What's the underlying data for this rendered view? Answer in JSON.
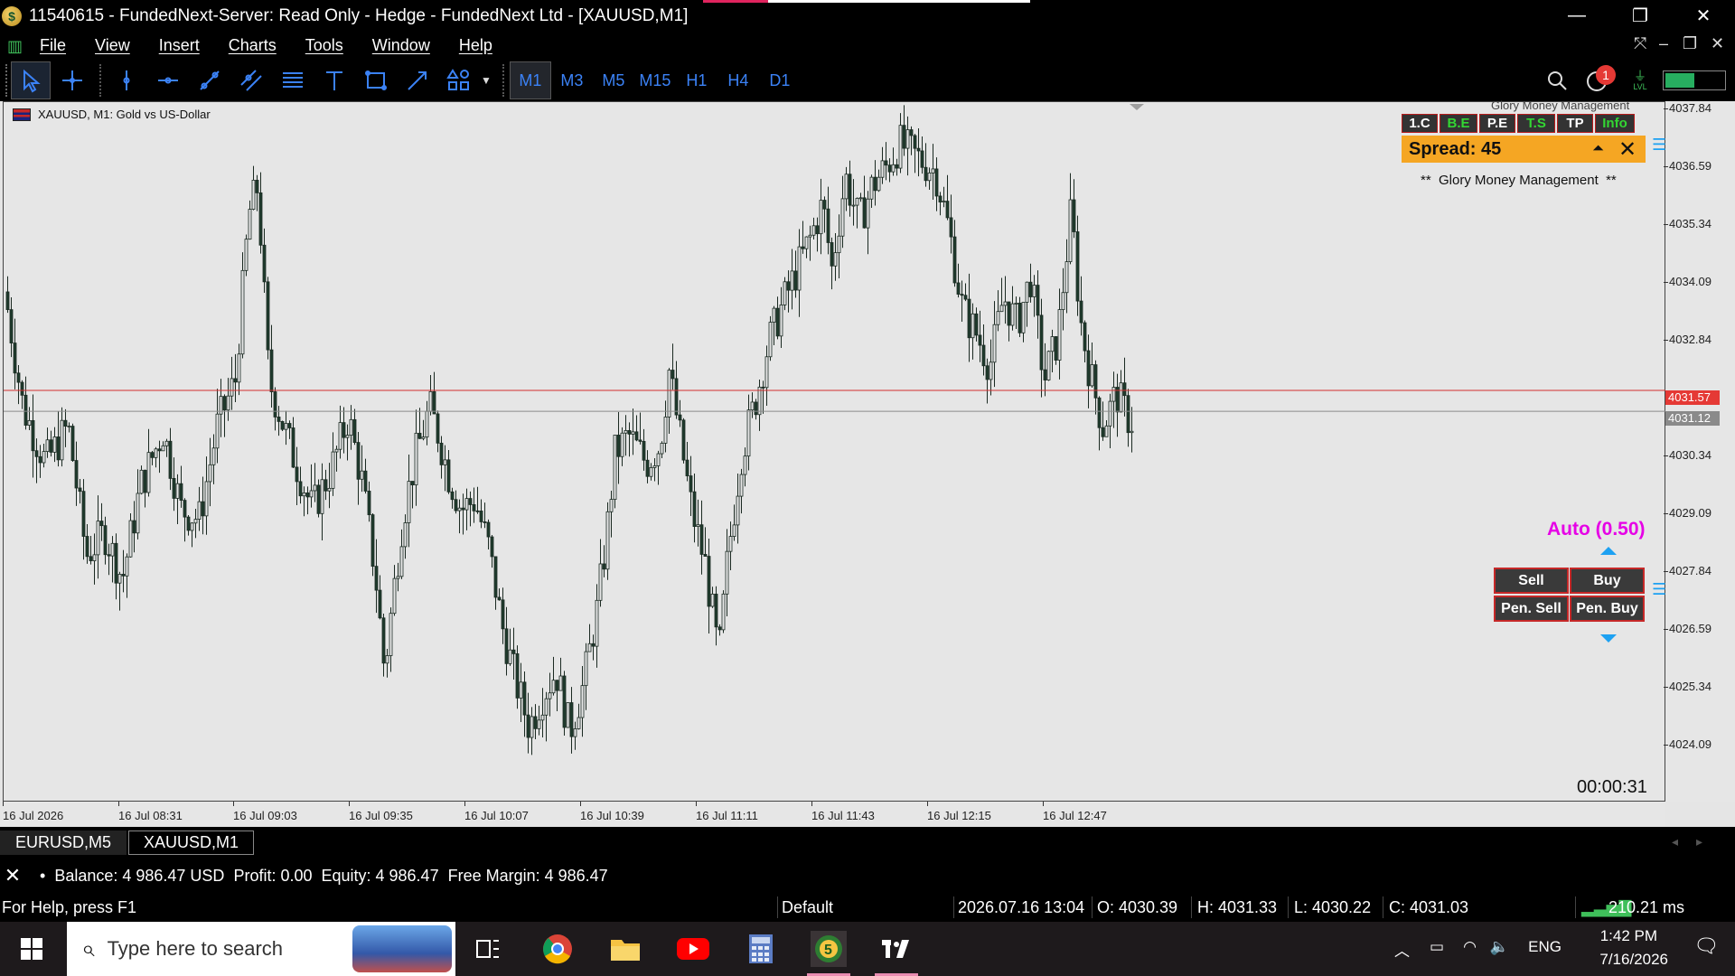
{
  "window": {
    "title": "11540615 - FundedNext-Server: Read Only - Hedge - FundedNext Ltd - [XAUUSD,M1]",
    "minimize": "—",
    "restore": "❐",
    "close": "✕"
  },
  "menu": {
    "items": [
      "File",
      "View",
      "Insert",
      "Charts",
      "Tools",
      "Window",
      "Help"
    ]
  },
  "toolbar": {
    "timeframes": [
      "M1",
      "M3",
      "M5",
      "M15",
      "H1",
      "H4",
      "D1"
    ],
    "active_timeframe": "M1",
    "notification_count": "1",
    "lvl_label": "LVL"
  },
  "chart": {
    "symbol_label": "XAUUSD, M1:  Gold vs US-Dollar",
    "price_ticks": [
      "4037.84",
      "4036.59",
      "4035.34",
      "4034.09",
      "4032.84",
      "4031.57",
      "4031.12",
      "4030.34",
      "4029.09",
      "4027.84",
      "4026.59",
      "4025.34",
      "4024.09"
    ],
    "axis_ticks": [
      "4037.84",
      "4036.59",
      "4035.34",
      "4034.09",
      "4032.84",
      "4030.34",
      "4029.09",
      "4027.84",
      "4026.59",
      "4025.34",
      "4024.09"
    ],
    "ask_price": "4031.57",
    "bid_price": "4031.12",
    "time_ticks": [
      "16 Jul 2026",
      "16 Jul 08:31",
      "16 Jul 09:03",
      "16 Jul 09:35",
      "16 Jul 10:07",
      "16 Jul 10:39",
      "16 Jul 11:11",
      "16 Jul 11:43",
      "16 Jul 12:15",
      "16 Jul 12:47"
    ],
    "colors": {
      "bull": "#e6e6e6",
      "bear": "#1f3b2d",
      "ask_line": "#d32f2f",
      "bid_line": "#8a8a8a"
    }
  },
  "panel": {
    "header_partial": "Glory Money Management",
    "buttons": [
      {
        "label": "1.C",
        "green": false
      },
      {
        "label": "B.E",
        "green": true
      },
      {
        "label": "P.E",
        "green": false
      },
      {
        "label": "T.S",
        "green": true
      },
      {
        "label": "TP",
        "green": false
      },
      {
        "label": "Info",
        "green": true
      }
    ],
    "spread": "Spread: 45",
    "up_arrow": "⏶",
    "close": "✕",
    "subtitle": "**  Glory Money Management  **",
    "auto": "Auto (0.50)",
    "sell": "Sell",
    "buy": "Buy",
    "pen_sell": "Pen. Sell",
    "pen_buy": "Pen. Buy",
    "countdown": "00:00:31"
  },
  "tabs": [
    "EURUSD,M5",
    "XAUUSD,M1"
  ],
  "active_tab": "XAUUSD,M1",
  "terminal": {
    "balance": "Balance: 4 986.47 USD",
    "profit": "Profit: 0.00",
    "equity": "Equity: 4 986.47",
    "free_margin": "Free Margin: 4 986.47"
  },
  "status": {
    "help": "For Help, press F1",
    "profile": "Default",
    "datetime": "2026.07.16 13:04",
    "open": "O: 4030.39",
    "high": "H: 4031.33",
    "low": "L: 4030.22",
    "close": "C: 4031.03",
    "ping": "210.21 ms"
  },
  "taskbar": {
    "search_placeholder": "Type here to search",
    "lang": "ENG",
    "time": "1:42 PM",
    "date": "7/16/2026"
  }
}
